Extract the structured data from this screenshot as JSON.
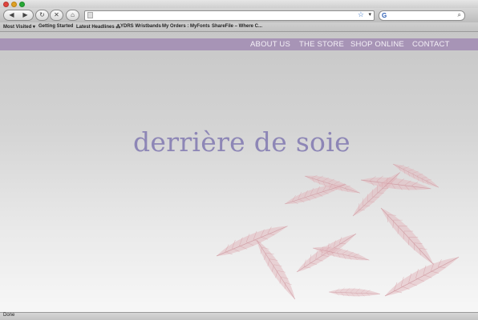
{
  "browser": {
    "search_engine_icon": "G",
    "bookmarks": [
      "Most Visited ▾",
      "Getting Started",
      "Latest Headlines ⁂",
      "YDRS Wristbands",
      "My Orders : MyFonts",
      "ShareFile – Where C..."
    ],
    "status": "Done",
    "icons": {
      "back": "◀",
      "forward": "▶",
      "reload": "↻",
      "stop": "✕",
      "home": "⌂",
      "star": "☆",
      "dropdown": "▾",
      "magnifier": "⌕"
    }
  },
  "site": {
    "nav": [
      "ABOUT US",
      "THE STORE",
      "SHOP ONLINE",
      "CONTACT"
    ],
    "logo": "derrière de soie",
    "colors": {
      "nav_bg": "#a794b6",
      "logo": "#8d86b6",
      "feather": "#d8a8ad"
    }
  }
}
